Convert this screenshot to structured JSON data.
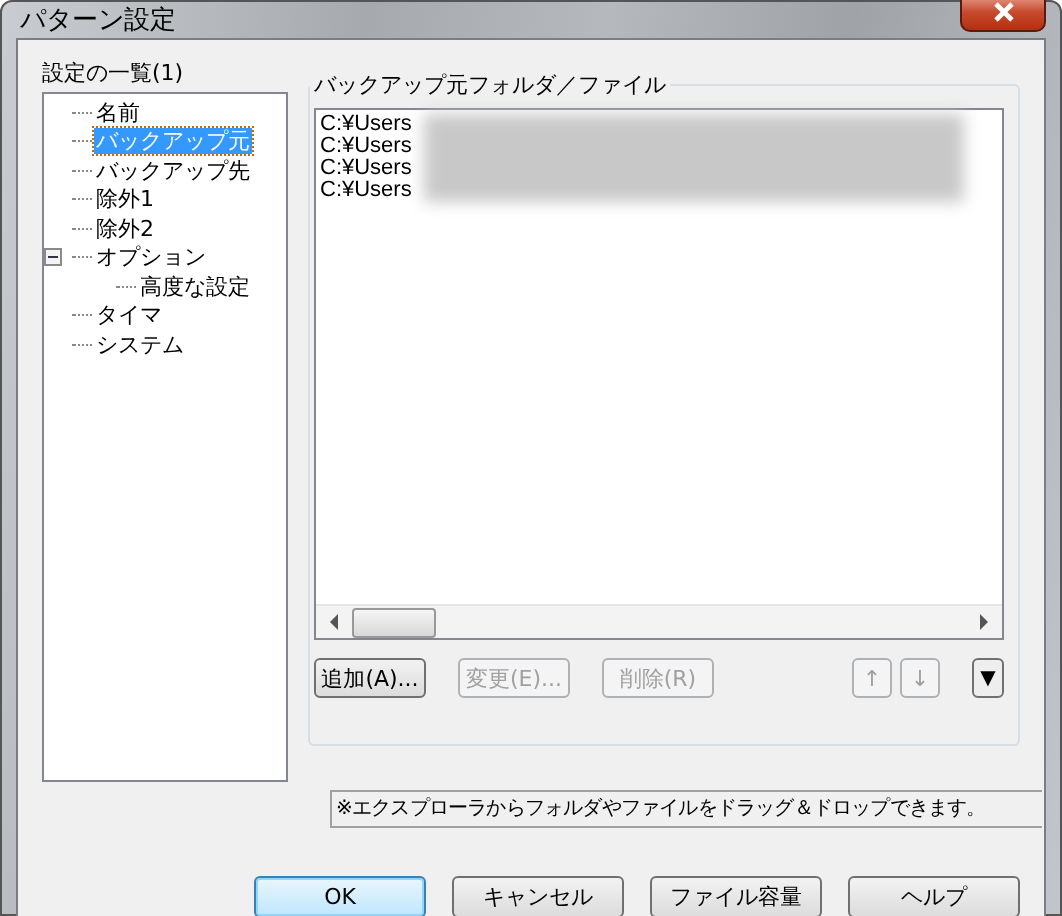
{
  "window": {
    "title": "パターン設定"
  },
  "settings_list": {
    "label": "設定の一覧(1)",
    "items": [
      {
        "label": "名前",
        "selected": false
      },
      {
        "label": "バックアップ元",
        "selected": true
      },
      {
        "label": "バックアップ先",
        "selected": false
      },
      {
        "label": "除外1",
        "selected": false
      },
      {
        "label": "除外2",
        "selected": false
      },
      {
        "label": "オプション",
        "selected": false,
        "expanded": true,
        "children": [
          {
            "label": "高度な設定",
            "selected": false
          }
        ]
      },
      {
        "label": "タイマ",
        "selected": false
      },
      {
        "label": "システム",
        "selected": false
      }
    ]
  },
  "source_group": {
    "title": "バックアップ元フォルダ／ファイル",
    "paths": [
      "C:¥Users",
      "C:¥Users",
      "C:¥Users",
      "C:¥Users"
    ],
    "buttons": [
      {
        "label": "追加(A)...",
        "disabled": false
      },
      {
        "label": "変更(E)...",
        "disabled": true
      },
      {
        "label": "削除(R)",
        "disabled": true
      }
    ],
    "arrows": [
      {
        "label": "↑",
        "disabled": true
      },
      {
        "label": "↓",
        "disabled": true
      }
    ],
    "menu_button": "▼",
    "note": "※エクスプローラからフォルダやファイルをドラッグ＆ドロップできます。"
  },
  "buttons": [
    {
      "label": "OK",
      "default": true
    },
    {
      "label": "キャンセル",
      "default": false
    },
    {
      "label": "ファイル容量",
      "default": false
    },
    {
      "label": "ヘルプ",
      "default": false
    }
  ]
}
